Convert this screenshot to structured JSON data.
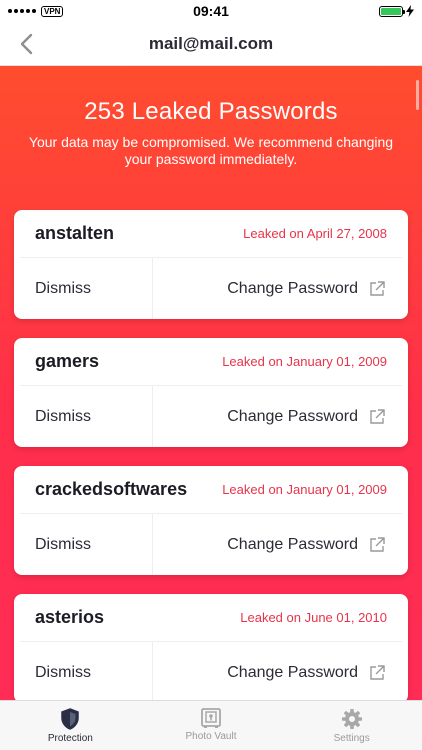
{
  "status_bar": {
    "carrier_badge": "VPN",
    "time": "09:41"
  },
  "nav": {
    "title": "mail@mail.com",
    "back_icon": "chevron-left-icon"
  },
  "summary": {
    "headline": "253 Leaked Passwords",
    "message": "Your data may be compromised. We recommend changing your password immediately."
  },
  "leaks": [
    {
      "name": "anstalten",
      "date": "Leaked on April 27, 2008",
      "dismiss_label": "Dismiss",
      "change_label": "Change Password"
    },
    {
      "name": "gamers",
      "date": "Leaked on January 01, 2009",
      "dismiss_label": "Dismiss",
      "change_label": "Change Password"
    },
    {
      "name": "crackedsoftwares",
      "date": "Leaked on January 01, 2009",
      "dismiss_label": "Dismiss",
      "change_label": "Change Password"
    },
    {
      "name": "asterios",
      "date": "Leaked on June 01, 2010",
      "dismiss_label": "Dismiss",
      "change_label": "Change Password"
    }
  ],
  "tabs": [
    {
      "label": "Protection",
      "icon": "shield-icon",
      "active": true
    },
    {
      "label": "Photo Vault",
      "icon": "vault-icon",
      "active": false
    },
    {
      "label": "Settings",
      "icon": "gear-icon",
      "active": false
    }
  ],
  "colors": {
    "gradient_top": "#ff4d2e",
    "gradient_bottom": "#ff2c56",
    "date_text": "#e8344a",
    "battery": "#34c759"
  }
}
